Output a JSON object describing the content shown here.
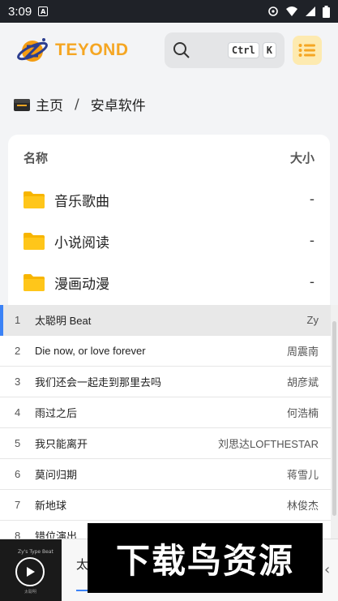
{
  "status_bar": {
    "time": "3:09",
    "notification_letter": "A"
  },
  "header": {
    "logo_text": "TEYOND",
    "search": {
      "key1": "Ctrl",
      "key2": "K"
    }
  },
  "breadcrumb": {
    "home": "主页",
    "separator": "/",
    "current": "安卓软件"
  },
  "file_table": {
    "col_name": "名称",
    "col_size": "大小",
    "rows": [
      {
        "name": "音乐歌曲",
        "size": "-"
      },
      {
        "name": "小说阅读",
        "size": "-"
      },
      {
        "name": "漫画动漫",
        "size": "-"
      }
    ]
  },
  "playlist": {
    "tracks": [
      {
        "num": "1",
        "title": "太聪明 Beat",
        "artist": "Zy"
      },
      {
        "num": "2",
        "title": "Die now, or love forever",
        "artist": "周震南"
      },
      {
        "num": "3",
        "title": "我们还会一起走到那里去吗",
        "artist": "胡彦斌"
      },
      {
        "num": "4",
        "title": "雨过之后",
        "artist": "何浩楠"
      },
      {
        "num": "5",
        "title": "我只能离开",
        "artist": "刘思达LOFTHESTAR"
      },
      {
        "num": "6",
        "title": "莫问归期",
        "artist": "蒋雪儿"
      },
      {
        "num": "7",
        "title": "新地球",
        "artist": "林俊杰"
      },
      {
        "num": "8",
        "title": "错位演出",
        "artist": ""
      }
    ]
  },
  "mini_player": {
    "cover_caption": "Zy's Type Beat",
    "cover_footer": "太聪明",
    "title": "太"
  },
  "watermark": {
    "text": "下载鸟资源"
  },
  "colors": {
    "accent": "#f5a623",
    "active_bar": "#3b82f6",
    "folder": "#f7b500"
  }
}
